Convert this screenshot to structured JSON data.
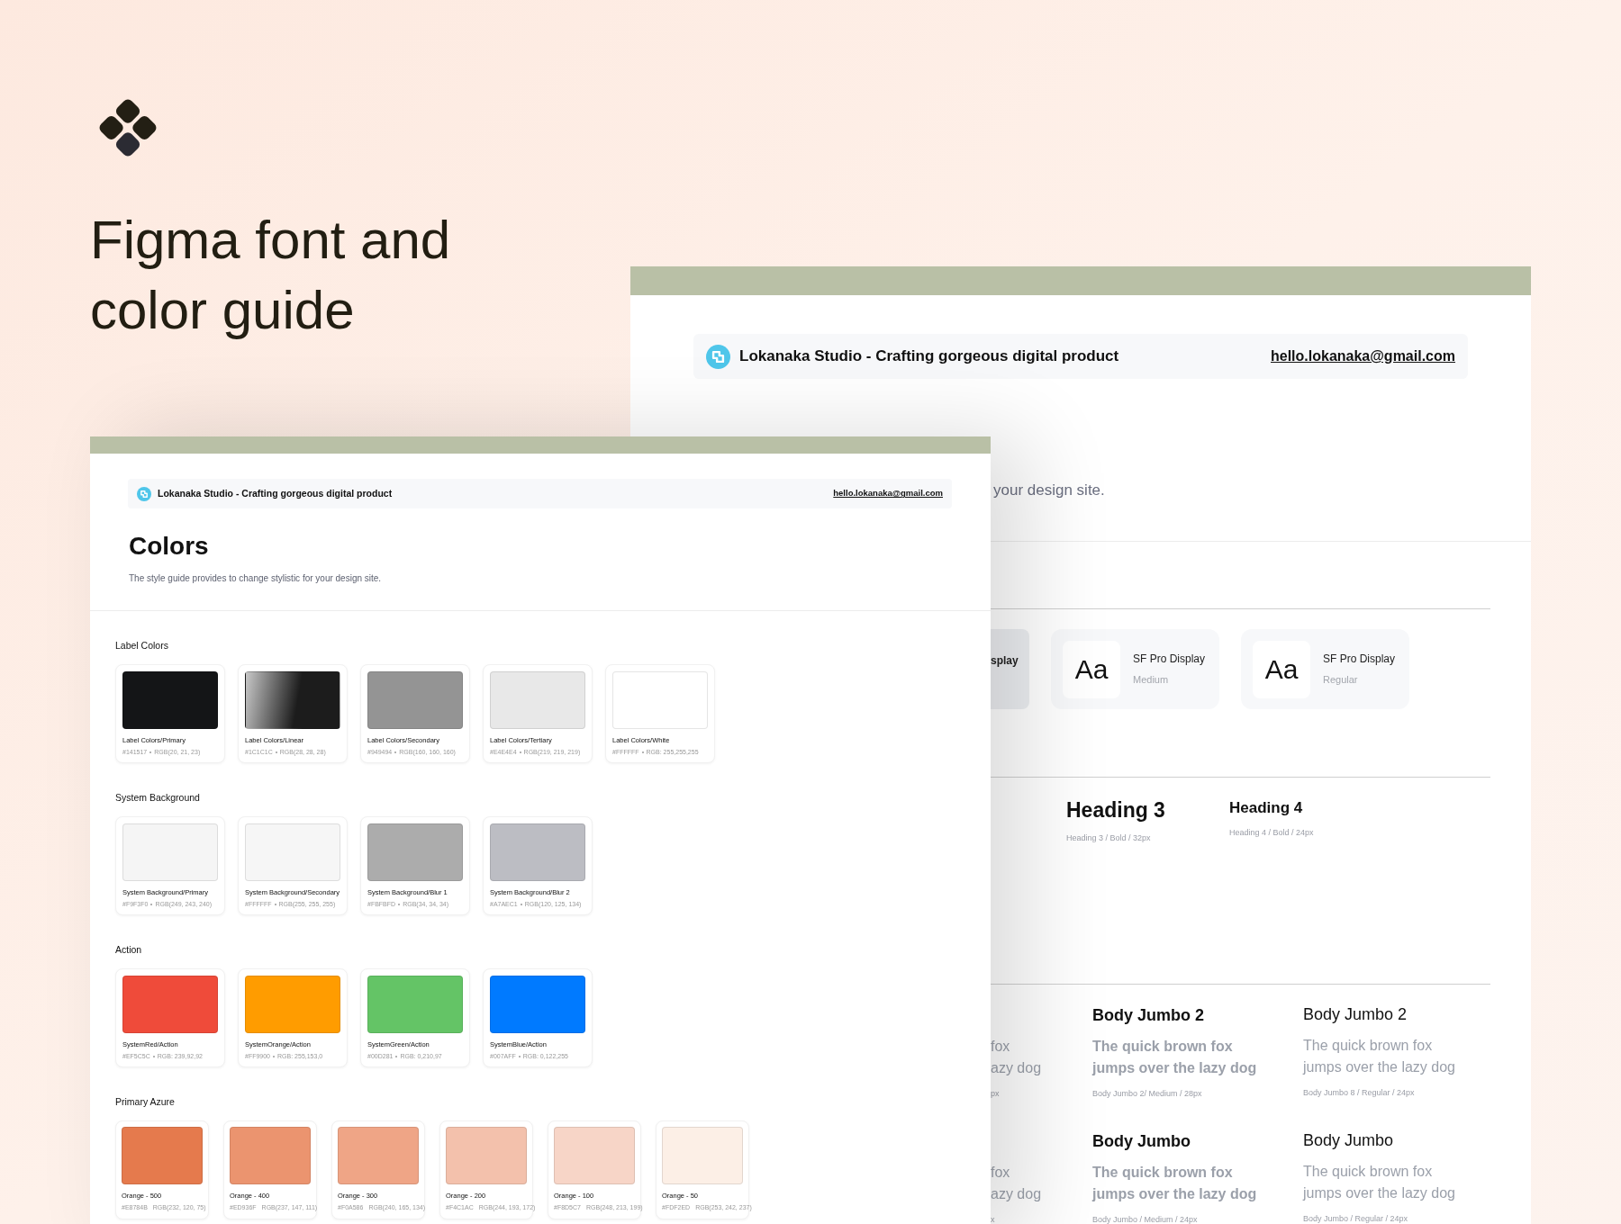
{
  "hero": {
    "title_lines": [
      "Figma font and",
      "color guide"
    ]
  },
  "typography_page": {
    "header": {
      "studio": "Lokanaka Studio - Crafting gorgeous digital product",
      "email": "hello.lokanaka@gmail.com"
    },
    "subtitle": "your design site.",
    "font_chips": [
      {
        "kind": "clipped",
        "name": "splay"
      },
      {
        "kind": "full",
        "sample": "Aa",
        "name": "SF Pro Display",
        "weight": "Medium"
      },
      {
        "kind": "full",
        "sample": "Aa",
        "name": "SF Pro Display",
        "weight": "Regular"
      }
    ],
    "headings": [
      {
        "label": "Heading 3",
        "spec": "Heading 3 / Bold / 32px",
        "kind": "h3"
      },
      {
        "label": "Heading 4",
        "spec": "Heading 4 / Bold / 24px",
        "kind": "h4"
      }
    ],
    "clipped_body": [
      {
        "lines": [
          "fox",
          "azy dog"
        ],
        "spec": "px"
      },
      {
        "lines": [
          "fox",
          "azy dog"
        ],
        "spec": "x"
      }
    ],
    "body_columns": [
      [
        {
          "title": "Body Jumbo 2",
          "lines": [
            "The quick brown fox",
            "jumps over the lazy dog"
          ],
          "spec": "Body Jumbo 2/ Medium / 28px",
          "kind": "medium"
        },
        {
          "title": "Body Jumbo",
          "lines": [
            "The quick brown fox",
            "jumps over the lazy dog"
          ],
          "spec": "Body Jumbo / Medium / 24px",
          "kind": "medium"
        }
      ],
      [
        {
          "title": "Body Jumbo 2",
          "lines": [
            "The quick brown fox",
            "jumps over the lazy dog"
          ],
          "spec": "Body Jumbo 8 / Regular / 24px",
          "kind": "regular"
        },
        {
          "title": "Body Jumbo",
          "lines": [
            "The quick brown fox",
            "jumps over the lazy dog"
          ],
          "spec": "Body Jumbo / Regular / 24px",
          "kind": "regular"
        }
      ]
    ]
  },
  "colors_page": {
    "header": {
      "studio": "Lokanaka Studio - Crafting gorgeous digital product",
      "email": "hello.lokanaka@gmail.com"
    },
    "title": "Colors",
    "description": "The style guide provides to change stylistic for your design site.",
    "sections": [
      {
        "title": "Label Colors",
        "kind": "large",
        "swatches": [
          {
            "name": "Label Colors/Primary",
            "hex": "#141517",
            "rgb": "RGB(20, 21, 23)",
            "kind": "solid",
            "color": "#141517"
          },
          {
            "name": "Label Colors/Linear",
            "hex": "#1C1C1C",
            "rgb": "RGB(28, 28, 28)",
            "kind": "gradient",
            "color": "#1c1c1c"
          },
          {
            "name": "Label Colors/Secondary",
            "hex": "#949494",
            "rgb": "RGB(160, 160, 160)",
            "kind": "solid",
            "color": "#949494"
          },
          {
            "name": "Label Colors/Tertiary",
            "hex": "#E4E4E4",
            "rgb": "RGB(219, 219, 219)",
            "kind": "solid",
            "color": "#e8e8e8"
          },
          {
            "name": "Label Colors/White",
            "hex": "#FFFFFF",
            "rgb": "RGB: 255,255,255",
            "kind": "solid",
            "color": "#ffffff"
          }
        ]
      },
      {
        "title": "System Background",
        "kind": "large",
        "swatches": [
          {
            "name": "System Background/Primary",
            "hex": "#F9F3F0",
            "rgb": "RGB(249, 243, 240)",
            "kind": "solid",
            "color": "#f5f5f5"
          },
          {
            "name": "System Background/Secondary",
            "hex": "#FFFFFF",
            "rgb": "RGB(255, 255, 255)",
            "kind": "solid",
            "color": "#f6f6f6"
          },
          {
            "name": "System Background/Blur 1",
            "hex": "#FBFBFD",
            "rgb": "RGB(34, 34, 34)",
            "kind": "solid",
            "color": "#acacac"
          },
          {
            "name": "System Background/Blur 2",
            "hex": "#A7AEC1",
            "rgb": "RGB(120, 125, 134)",
            "kind": "solid",
            "color": "#bcbdc3"
          }
        ]
      },
      {
        "title": "Action",
        "kind": "large",
        "swatches": [
          {
            "name": "SystemRed/Action",
            "hex": "#EF5C5C",
            "rgb": "RGB: 239,92,92",
            "kind": "solid",
            "color": "#ef4b3a"
          },
          {
            "name": "SystemOrange/Action",
            "hex": "#FF9900",
            "rgb": "RGB: 255,153,0",
            "kind": "solid",
            "color": "#ff9c00"
          },
          {
            "name": "SystemGreen/Action",
            "hex": "#00D281",
            "rgb": "RGB: 0,210,97",
            "kind": "solid",
            "color": "#64c466"
          },
          {
            "name": "SystemBlue/Action",
            "hex": "#007AFF",
            "rgb": "RGB: 0,122,255",
            "kind": "solid",
            "color": "#007aff"
          }
        ]
      },
      {
        "title": "Primary Azure",
        "kind": "small",
        "swatches": [
          {
            "name": "Orange - 500",
            "hex": "#E8784B",
            "rgb": "RGB(232, 120, 75)",
            "kind": "solid",
            "color": "#e57a4d"
          },
          {
            "name": "Orange - 400",
            "hex": "#ED936F",
            "rgb": "RGB(237, 147, 111)",
            "kind": "solid",
            "color": "#eb946f"
          },
          {
            "name": "Orange - 300",
            "hex": "#F0A586",
            "rgb": "RGB(240, 165, 134)",
            "kind": "solid",
            "color": "#efa586"
          },
          {
            "name": "Orange - 200",
            "hex": "#F4C1AC",
            "rgb": "RGB(244, 193, 172)",
            "kind": "solid",
            "color": "#f3c1ac"
          },
          {
            "name": "Orange - 100",
            "hex": "#F8D5C7",
            "rgb": "RGB(248, 213, 199)",
            "kind": "solid",
            "color": "#f7d5c7"
          },
          {
            "name": "Orange - 50",
            "hex": "#FDF2ED",
            "rgb": "RGB(253, 242, 237)",
            "kind": "solid",
            "color": "#fcefe6"
          }
        ]
      }
    ]
  }
}
